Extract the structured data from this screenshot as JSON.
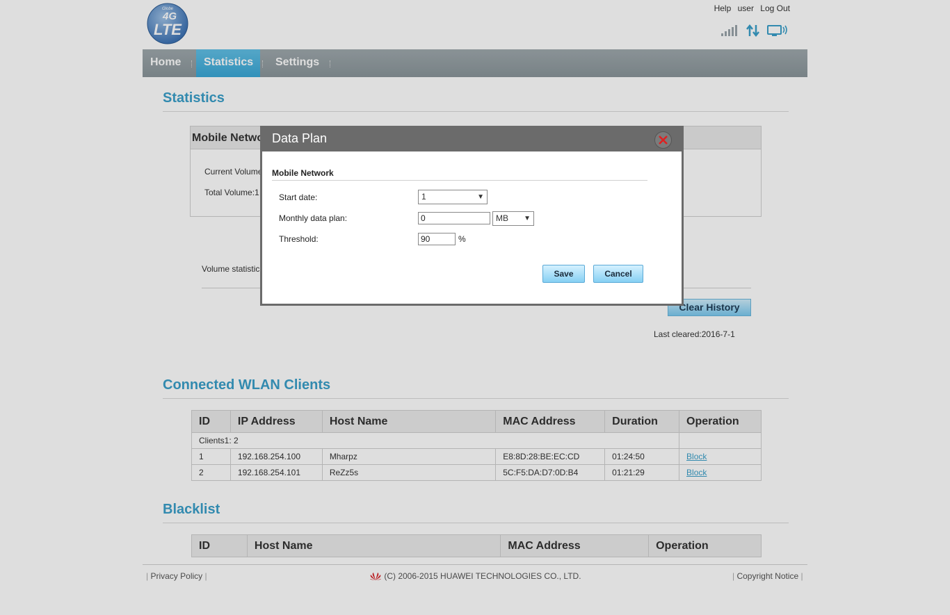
{
  "header": {
    "logo_top": "Globe",
    "logo_main": "4G",
    "logo_sub": "LTE",
    "links": [
      "Help",
      "user",
      "Log Out"
    ]
  },
  "nav": {
    "items": [
      "Home",
      "Statistics",
      "Settings"
    ],
    "active": "Statistics"
  },
  "statistics": {
    "title": "Statistics",
    "box_title": "Mobile Netwo",
    "current_volume": "Current Volume",
    "total_volume": "Total Volume:1",
    "volume_statistics": "Volume statistic",
    "clear_history": "Clear History",
    "last_cleared": "Last cleared:2016-7-1"
  },
  "wlan": {
    "title": "Connected WLAN Clients",
    "columns": [
      "ID",
      "IP Address",
      "Host Name",
      "MAC Address",
      "Duration",
      "Operation"
    ],
    "clients_label": "Clients1: 2",
    "rows": [
      {
        "id": "1",
        "ip": "192.168.254.100",
        "host": "Mharpz",
        "mac": "E8:8D:28:BE:EC:CD",
        "duration": "01:24:50",
        "op": "Block"
      },
      {
        "id": "2",
        "ip": "192.168.254.101",
        "host": "ReZz5s",
        "mac": "5C:F5:DA:D7:0D:B4",
        "duration": "01:21:29",
        "op": "Block"
      }
    ]
  },
  "blacklist": {
    "title": "Blacklist",
    "columns": [
      "ID",
      "Host Name",
      "MAC Address",
      "Operation"
    ]
  },
  "footer": {
    "privacy": "Privacy Policy",
    "copyright": "(C) 2006-2015 HUAWEI TECHNOLOGIES CO., LTD.",
    "notice": "Copyright Notice"
  },
  "dialog": {
    "title": "Data Plan",
    "section": "Mobile Network",
    "start_date_label": "Start date:",
    "start_date_value": "1",
    "monthly_label": "Monthly data plan:",
    "monthly_value": "0",
    "unit_value": "MB",
    "threshold_label": "Threshold:",
    "threshold_value": "90",
    "percent": "%",
    "save": "Save",
    "cancel": "Cancel"
  },
  "colors": {
    "accent": "#3a9fc9",
    "nav_bg": "#8f9a9f",
    "dialog_head": "#6b6b6b"
  },
  "status": {
    "signal_bars": 5,
    "icons": [
      "signal-icon",
      "data-transfer-icon",
      "wifi-connected-icon"
    ]
  }
}
